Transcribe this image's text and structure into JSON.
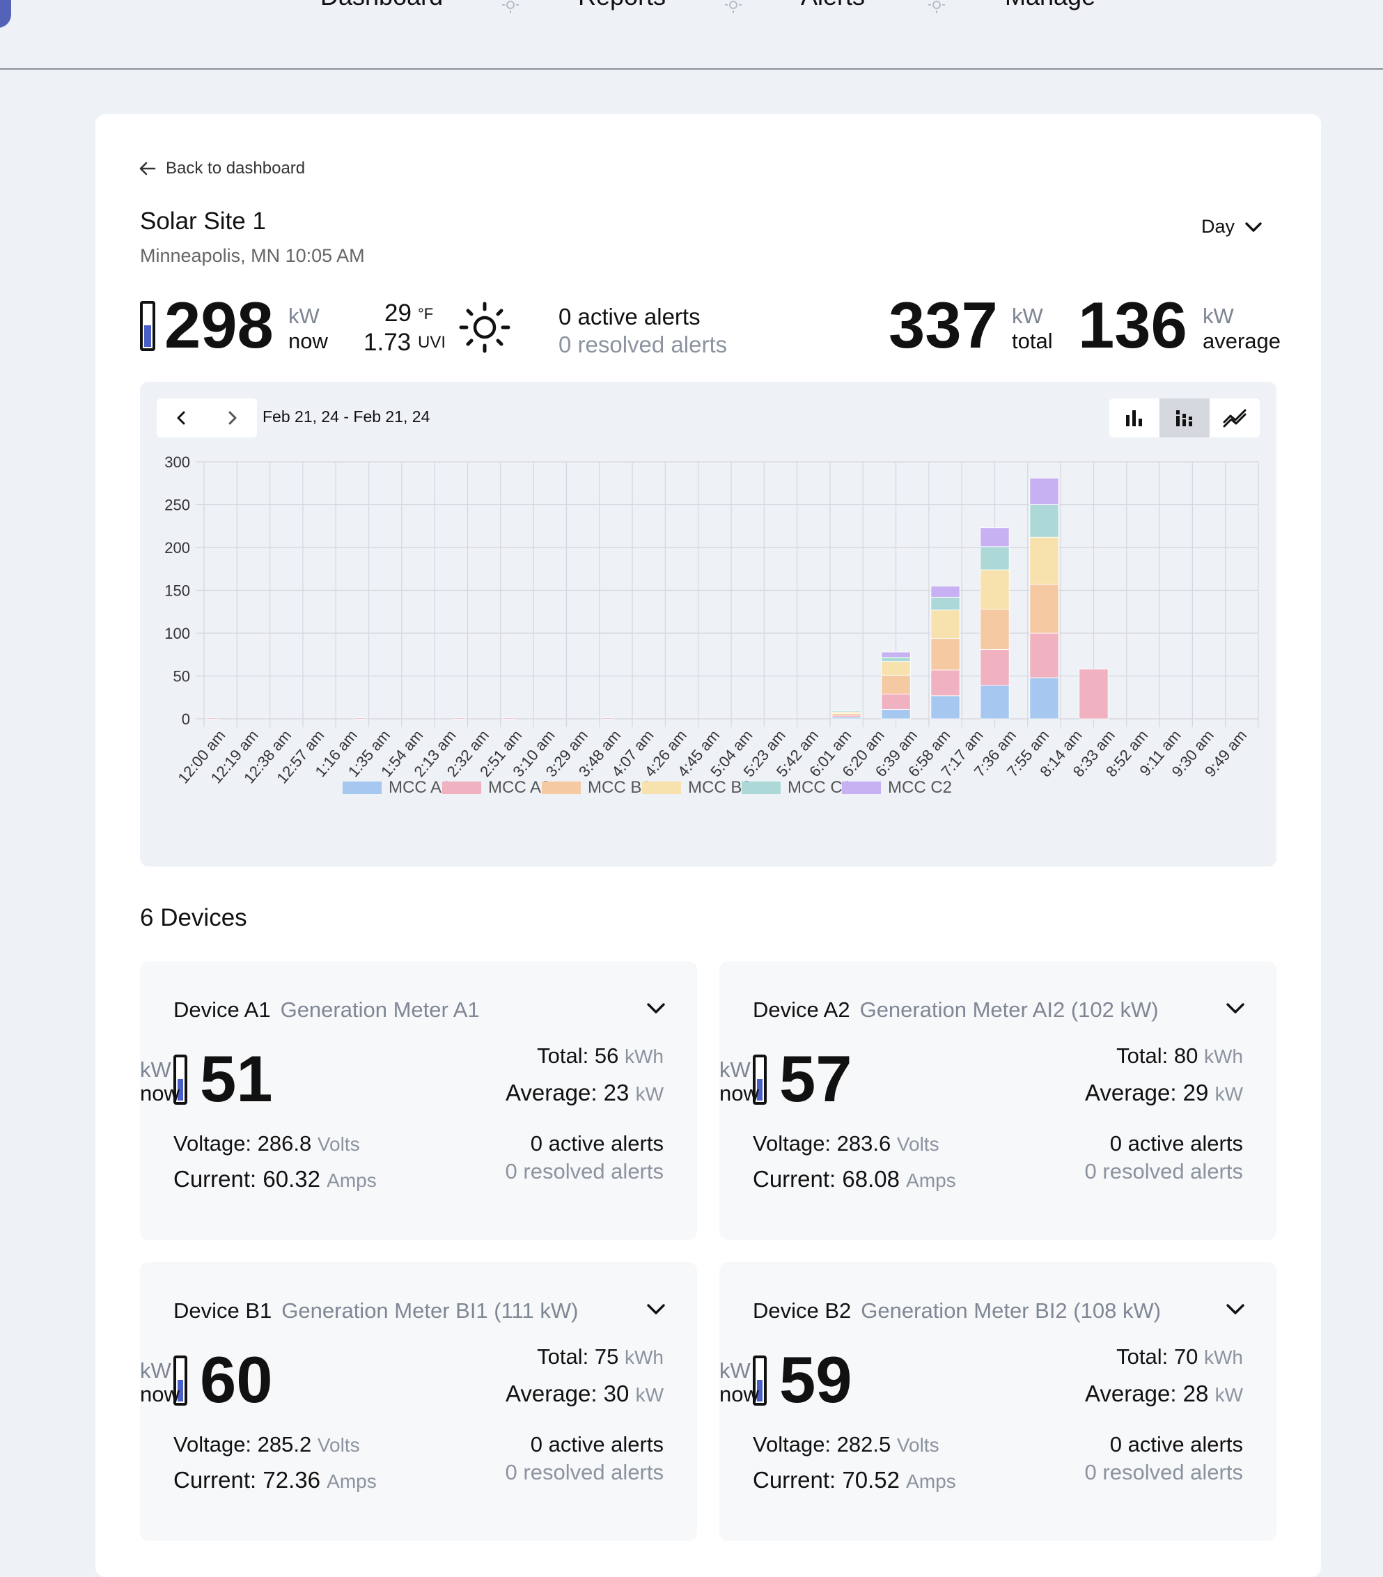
{
  "nav": {
    "items": [
      "Dashboard",
      "Reports",
      "Alerts",
      "Manage"
    ]
  },
  "site": {
    "back_label": "Back to dashboard",
    "name": "Solar Site 1",
    "location_time": "Minneapolis, MN 10:05 AM",
    "period": "Day",
    "power_now": "298",
    "power_level": 0.55,
    "power_unit": "kW",
    "now_label": "now",
    "temperature": "29",
    "temp_unit": "°F",
    "uvi": "1.73",
    "uvi_unit": "UVI",
    "active_alerts": "0 active alerts",
    "resolved_alerts": "0 resolved alerts",
    "total_value": "337",
    "total_unit": "kW",
    "total_label": "total",
    "avg_value": "136",
    "avg_unit": "kW",
    "avg_label": "average",
    "date_range": "Feb 21, 24 - Feb 21, 24"
  },
  "colors": {
    "accent": "#4a5fc7",
    "mcc_a1": "#a6c8f0",
    "mcc_a2": "#f0b1c0",
    "mcc_b1": "#f5c9a2",
    "mcc_b2": "#f7e2ae",
    "mcc_c1": "#acd9d8",
    "mcc_c2": "#c8b1f2"
  },
  "chart_data": {
    "type": "bar",
    "stacked": true,
    "categories": [
      "12:00 am",
      "12:19 am",
      "12:38 am",
      "12:57 am",
      "1:16 am",
      "1:35 am",
      "1:54 am",
      "2:13 am",
      "2:32 am",
      "2:51 am",
      "3:10 am",
      "3:29 am",
      "3:48 am",
      "4:07 am",
      "4:26 am",
      "4:45 am",
      "5:04 am",
      "5:23 am",
      "5:42 am",
      "6:01 am",
      "6:20 am",
      "6:39 am",
      "6:58 am",
      "7:17 am",
      "7:36 am",
      "7:55 am",
      "8:14 am",
      "8:33 am",
      "8:52 am",
      "9:11 am",
      "9:30 am",
      "9:49 am"
    ],
    "series": [
      {
        "name": "MCC A1",
        "values": [
          0,
          0,
          0,
          0,
          0,
          0,
          0,
          0,
          0,
          0,
          0,
          0,
          0,
          0,
          0,
          0,
          0,
          0,
          0,
          0,
          0,
          0,
          0,
          0,
          2,
          11,
          27,
          39,
          48,
          0
        ]
      },
      {
        "name": "MCC A2",
        "values": [
          1,
          0,
          0,
          0,
          0,
          0,
          1,
          0,
          0,
          0,
          1,
          0,
          1,
          0,
          0,
          0,
          1,
          0,
          0,
          0,
          0,
          0,
          0,
          0,
          2,
          18,
          30,
          42,
          52,
          58
        ]
      },
      {
        "name": "MCC B1",
        "values": [
          0,
          0,
          0,
          0,
          0,
          0,
          0,
          0,
          0,
          0,
          0,
          0,
          0,
          0,
          0,
          0,
          0,
          0,
          0,
          0,
          0,
          0,
          0,
          0,
          2,
          22,
          37,
          47,
          57,
          0
        ]
      },
      {
        "name": "MCC B2",
        "values": [
          0,
          0,
          0,
          0,
          0,
          0,
          0,
          0,
          0,
          0,
          0,
          0,
          0,
          0,
          0,
          0,
          0,
          0,
          0,
          0,
          0,
          0,
          0,
          0,
          2,
          16,
          33,
          46,
          55,
          0
        ]
      },
      {
        "name": "MCC C1",
        "values": [
          0,
          0,
          0,
          0,
          0,
          0,
          0,
          0,
          0,
          0,
          0,
          0,
          0,
          0,
          0,
          0,
          0,
          0,
          0,
          0,
          0,
          0,
          0,
          0,
          1,
          5,
          15,
          27,
          38,
          0
        ]
      },
      {
        "name": "MCC C2",
        "values": [
          0,
          0,
          0,
          0,
          0,
          0,
          0,
          0,
          0,
          0,
          0,
          0,
          0,
          0,
          0,
          0,
          0,
          0,
          0,
          0,
          0,
          0,
          0,
          0,
          0,
          6,
          13,
          22,
          31,
          0
        ]
      }
    ],
    "bar_slots": [
      0,
      2,
      3,
      5,
      6,
      8,
      9,
      11,
      12,
      14,
      15,
      17,
      18,
      20,
      21,
      23,
      24,
      26,
      27,
      29,
      30,
      32,
      33,
      35,
      38,
      41,
      44,
      47,
      50,
      53
    ],
    "slot_count": 32,
    "y_ticks": [
      0,
      50,
      100,
      150,
      200,
      250,
      300
    ],
    "ylim": [
      0,
      300
    ],
    "legend_position": "bottom",
    "grid": true
  },
  "devices_title": "6 Devices",
  "devices": [
    {
      "name": "Device A1",
      "desc": "Generation Meter A1",
      "power": "51",
      "level": 0.55,
      "unit": "kW",
      "now": "now",
      "total_label": "Total:",
      "total": "56",
      "total_unit": "kWh",
      "avg_label": "Average:",
      "avg": "23",
      "avg_unit": "kW",
      "voltage_label": "Voltage:",
      "voltage": "286.8",
      "voltage_unit": "Volts",
      "current_label": "Current:",
      "current": "60.32",
      "current_unit": "Amps",
      "active": "0 active alerts",
      "resolved": "0 resolved alerts"
    },
    {
      "name": "Device A2",
      "desc": "Generation Meter AI2 (102 kW)",
      "power": "57",
      "level": 0.55,
      "unit": "kW",
      "now": "now",
      "total_label": "Total:",
      "total": "80",
      "total_unit": "kWh",
      "avg_label": "Average:",
      "avg": "29",
      "avg_unit": "kW",
      "voltage_label": "Voltage:",
      "voltage": "283.6",
      "voltage_unit": "Volts",
      "current_label": "Current:",
      "current": "68.08",
      "current_unit": "Amps",
      "active": "0 active alerts",
      "resolved": "0 resolved alerts"
    },
    {
      "name": "Device B1",
      "desc": "Generation Meter BI1 (111 kW)",
      "power": "60",
      "level": 0.55,
      "unit": "kW",
      "now": "now",
      "total_label": "Total:",
      "total": "75",
      "total_unit": "kWh",
      "avg_label": "Average:",
      "avg": "30",
      "avg_unit": "kW",
      "voltage_label": "Voltage:",
      "voltage": "285.2",
      "voltage_unit": "Volts",
      "current_label": "Current:",
      "current": "72.36",
      "current_unit": "Amps",
      "active": "0 active alerts",
      "resolved": "0 resolved alerts"
    },
    {
      "name": "Device B2",
      "desc": "Generation Meter BI2 (108 kW)",
      "power": "59",
      "level": 0.55,
      "unit": "kW",
      "now": "now",
      "total_label": "Total:",
      "total": "70",
      "total_unit": "kWh",
      "avg_label": "Average:",
      "avg": "28",
      "avg_unit": "kW",
      "voltage_label": "Voltage:",
      "voltage": "282.5",
      "voltage_unit": "Volts",
      "current_label": "Current:",
      "current": "70.52",
      "current_unit": "Amps",
      "active": "0 active alerts",
      "resolved": "0 resolved alerts"
    }
  ]
}
